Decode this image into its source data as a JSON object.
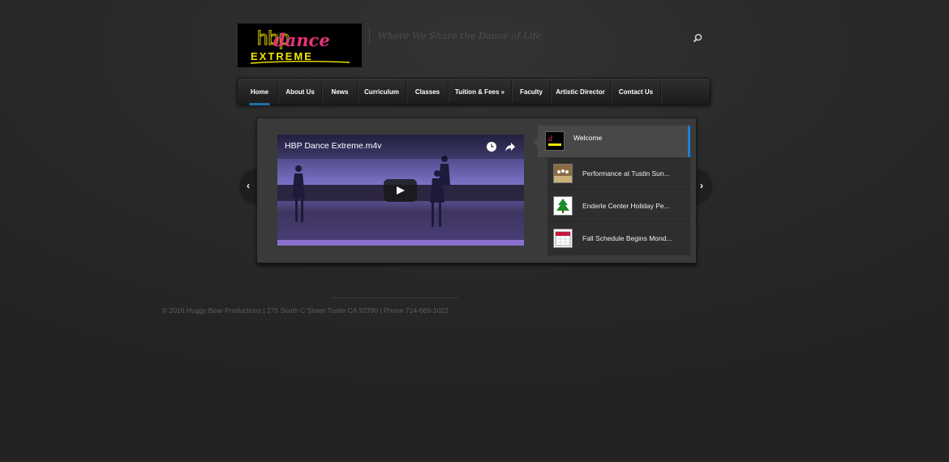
{
  "header": {
    "logo_text_top": "hbp",
    "logo_text_script": "dance",
    "logo_text_bottom": "EXTREME",
    "tagline": "Where We Share the Dance of Life"
  },
  "nav": {
    "items": [
      {
        "label": "Home"
      },
      {
        "label": "About Us"
      },
      {
        "label": "News"
      },
      {
        "label": "Curriculum"
      },
      {
        "label": "Classes"
      },
      {
        "label": "Tuition & Fees »"
      },
      {
        "label": "Faculty"
      },
      {
        "label": "Artistic Director"
      },
      {
        "label": "Contact Us"
      }
    ],
    "active": "Home"
  },
  "slider": {
    "video_title": "HBP Dance Extreme.m4v",
    "items": [
      {
        "label": "Welcome",
        "thumb_icon": "logo-thumb-icon"
      },
      {
        "label": "Performance at Tustin Sun...",
        "thumb_icon": "performance-thumb-icon"
      },
      {
        "label": "Enderle Center Holiday Pe...",
        "thumb_icon": "christmas-tree-icon"
      },
      {
        "label": "Fall Schedule Begins Mond...",
        "thumb_icon": "calendar-icon"
      }
    ]
  },
  "footer": {
    "text": "© 2016 Huggy Bear Productions | 275 South C Street Tustin CA 92780 | Phone 714-669-1022"
  },
  "colors": {
    "accent": "#1a7fd6",
    "logo_yellow": "#f2e600",
    "logo_pink": "#e8327a"
  }
}
